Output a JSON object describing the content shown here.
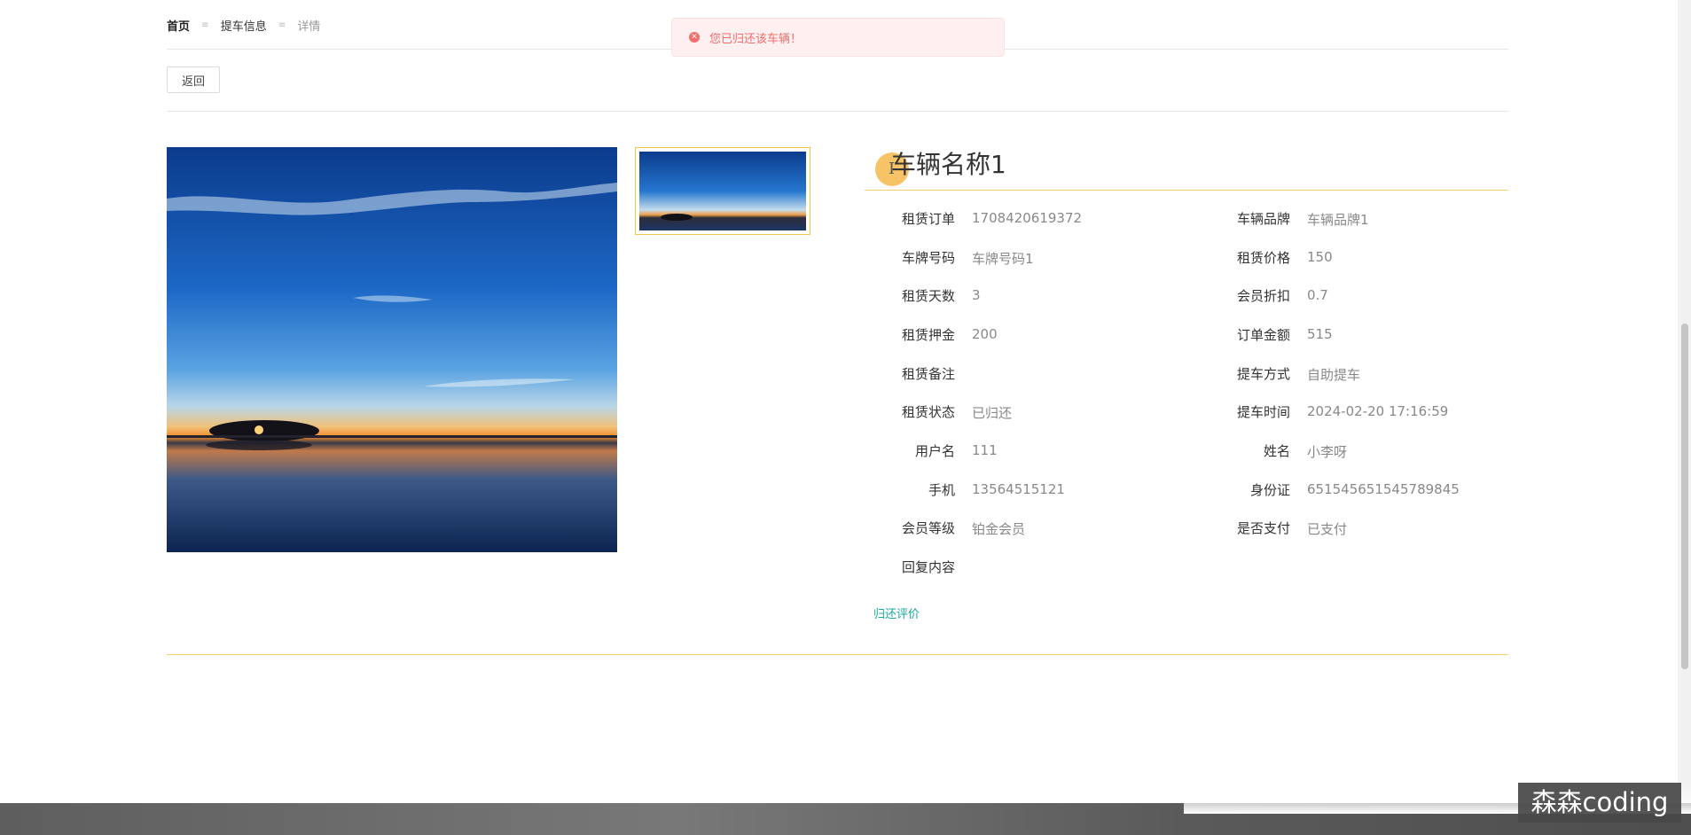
{
  "breadcrumb": {
    "home": "首页",
    "sep": "≡",
    "section": "提车信息",
    "current": "详情"
  },
  "toast": {
    "message": "您已归还该车辆！",
    "icon": "error-circle-icon",
    "color": "#f56c6c"
  },
  "back_button": {
    "label": "返回"
  },
  "vehicle": {
    "name": "车辆名称1"
  },
  "details": {
    "left": [
      {
        "label": "租赁订单",
        "value": "1708420619372"
      },
      {
        "label": "车牌号码",
        "value": "车牌号码1"
      },
      {
        "label": "租赁天数",
        "value": "3"
      },
      {
        "label": "租赁押金",
        "value": "200"
      },
      {
        "label": "租赁备注",
        "value": ""
      },
      {
        "label": "租赁状态",
        "value": "已归还"
      },
      {
        "label": "用户名",
        "value": "111"
      },
      {
        "label": "手机",
        "value": "13564515121"
      },
      {
        "label": "会员等级",
        "value": "铂金会员"
      },
      {
        "label": "回复内容",
        "value": ""
      }
    ],
    "right": [
      {
        "label": "车辆品牌",
        "value": "车辆品牌1"
      },
      {
        "label": "租赁价格",
        "value": "150"
      },
      {
        "label": "会员折扣",
        "value": "0.7"
      },
      {
        "label": "订单金额",
        "value": "515"
      },
      {
        "label": "提车方式",
        "value": "自助提车"
      },
      {
        "label": "提车时间",
        "value": "2024-02-20 17:16:59"
      },
      {
        "label": "姓名",
        "value": "小李呀"
      },
      {
        "label": "身份证",
        "value": "651545651545789845"
      },
      {
        "label": "是否支付",
        "value": "已支付"
      }
    ]
  },
  "review_link": {
    "label": "归还评价"
  },
  "watermark": {
    "text": "森森coding"
  },
  "colors": {
    "accent": "#f3cf6a",
    "link": "#1ca89a",
    "toast_bg": "#fef0f0"
  }
}
